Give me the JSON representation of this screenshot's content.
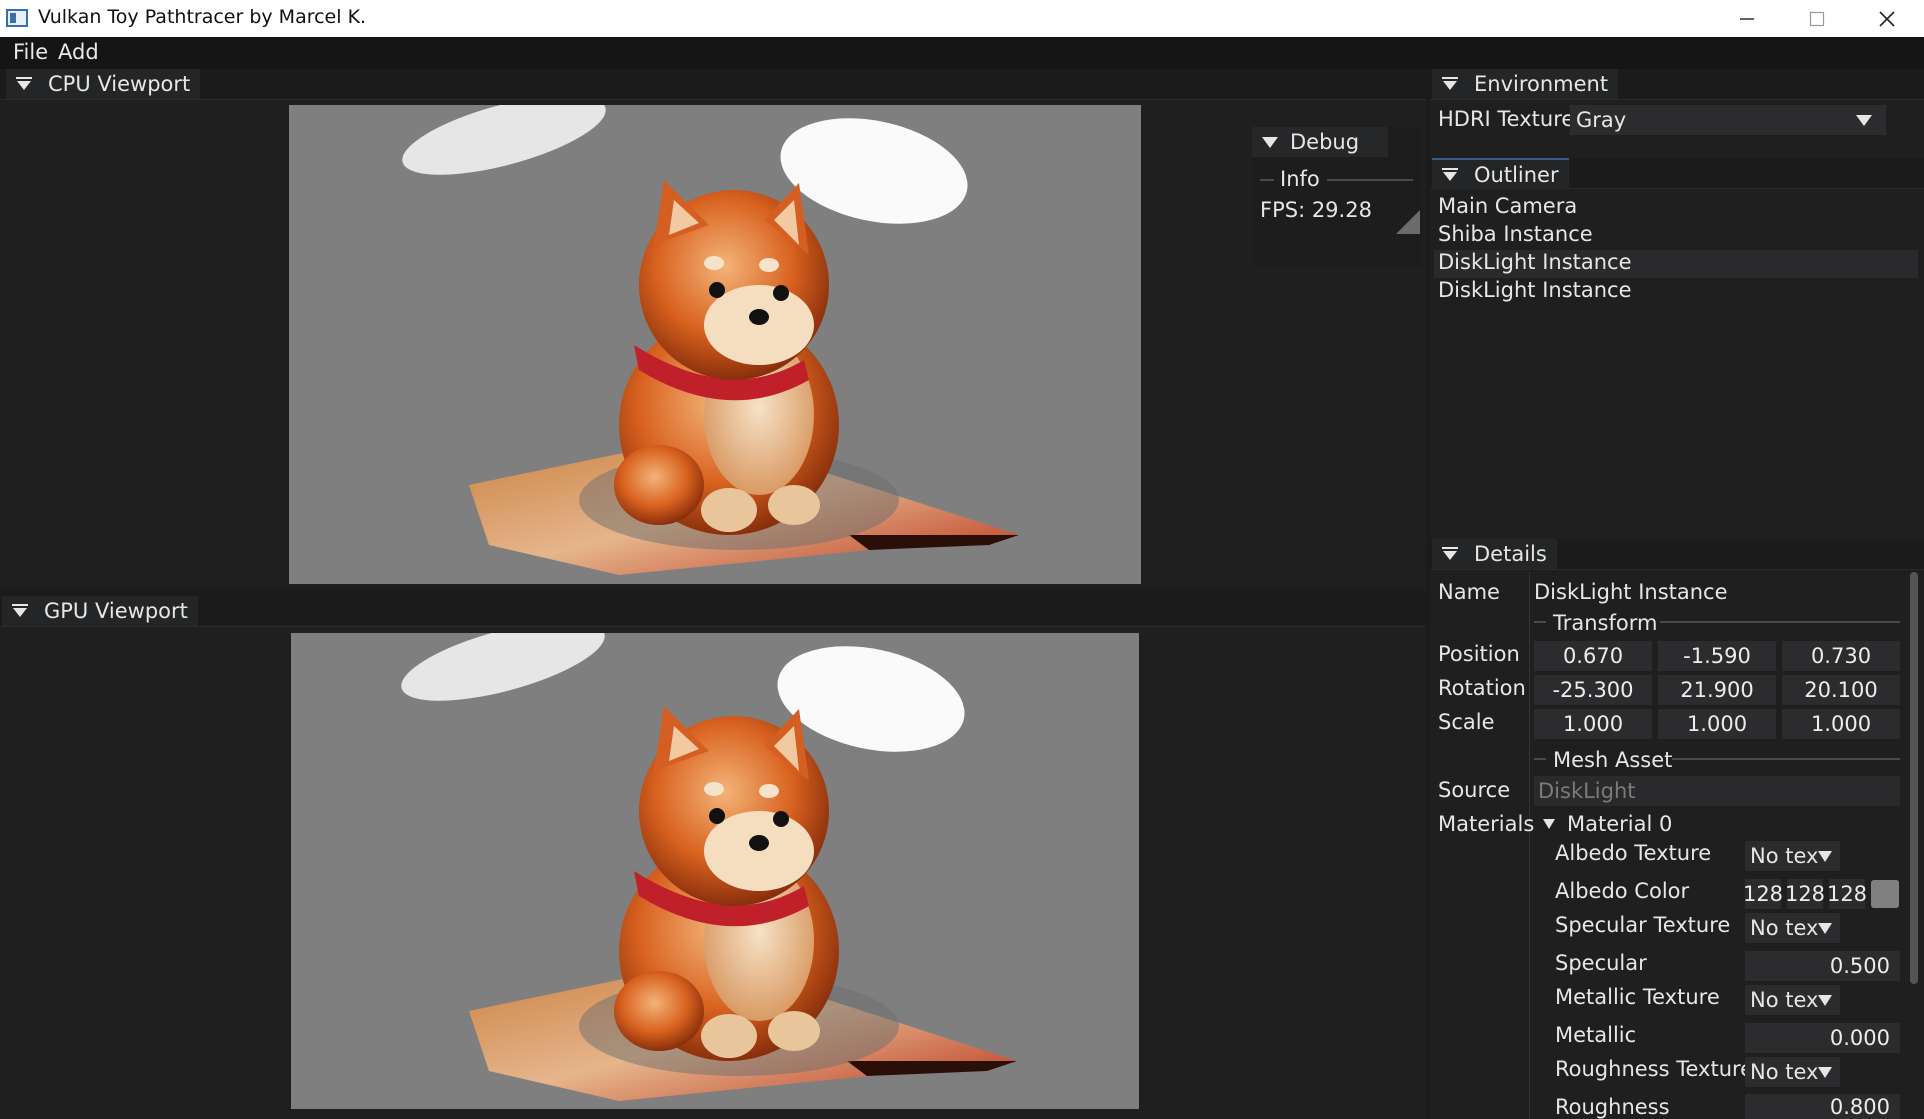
{
  "window": {
    "title": "Vulkan Toy Pathtracer by Marcel K."
  },
  "menu": {
    "items": [
      "File",
      "Add"
    ]
  },
  "cpu_viewport": {
    "title": "CPU Viewport"
  },
  "gpu_viewport": {
    "title": "GPU Viewport"
  },
  "debug": {
    "title": "Debug",
    "info_label": "Info",
    "fps_text": "FPS: 29.28"
  },
  "environment": {
    "title": "Environment",
    "hdri_label": "HDRI Texture",
    "hdri_value": "Gray"
  },
  "outliner": {
    "title": "Outliner",
    "items": [
      "Main Camera",
      "Shiba Instance",
      "DiskLight Instance",
      "DiskLight Instance"
    ],
    "selected_index": 2
  },
  "details": {
    "title": "Details",
    "name_label": "Name",
    "name_value": "DiskLight Instance",
    "transform_label": "Transform",
    "position_label": "Position",
    "position": [
      "0.670",
      "-1.590",
      "0.730"
    ],
    "rotation_label": "Rotation",
    "rotation": [
      "-25.300",
      "21.900",
      "20.100"
    ],
    "scale_label": "Scale",
    "scale": [
      "1.000",
      "1.000",
      "1.000"
    ],
    "mesh_asset_label": "Mesh Asset",
    "source_label": "Source",
    "source_value": "DiskLight",
    "materials_label": "Materials",
    "material_name": "Material 0",
    "albedo_texture_label": "Albedo Texture",
    "albedo_texture_value": "No text",
    "albedo_color_label": "Albedo Color",
    "albedo_color": [
      "128",
      "128",
      "128"
    ],
    "albedo_swatch_color": "#808080",
    "specular_texture_label": "Specular Texture",
    "specular_texture_value": "No text",
    "specular_label": "Specular",
    "specular_value": "0.500",
    "metallic_texture_label": "Metallic Texture",
    "metallic_texture_value": "No text",
    "metallic_label": "Metallic",
    "metallic_value": "0.000",
    "roughness_texture_label": "Roughness Texture",
    "roughness_texture_value": "No text",
    "roughness_label": "Roughness",
    "roughness_value": "0.800"
  },
  "colors": {
    "viewport_bg": "#7f7f7f",
    "accent": "#3d5a8a"
  }
}
